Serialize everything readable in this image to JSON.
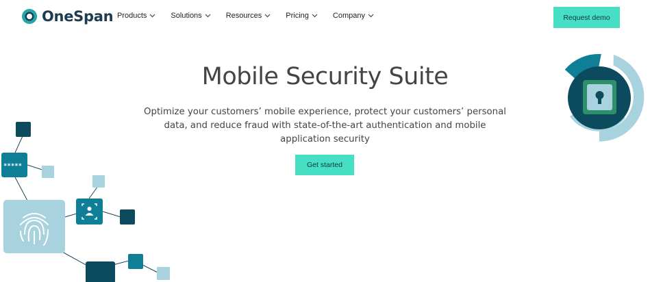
{
  "brand": {
    "name": "OneSpan"
  },
  "nav": {
    "items": [
      {
        "label": "Products"
      },
      {
        "label": "Solutions"
      },
      {
        "label": "Resources"
      },
      {
        "label": "Pricing"
      },
      {
        "label": "Company"
      }
    ],
    "cta_label": "Request demo"
  },
  "hero": {
    "title": "Mobile Security Suite",
    "description": "Optimize your customers’ mobile experience, protect your customers’ personal data, and reduce fraud with state-of-the-art authentication and mobile application security",
    "cta_label": "Get started"
  },
  "illustration": {
    "password_mask": "*****"
  },
  "colors": {
    "accent": "#46dfc4",
    "dark_teal": "#0c4a5e",
    "teal": "#0e7f96",
    "light_blue": "#a8d3de",
    "brand_dark": "#1e3b4f"
  }
}
